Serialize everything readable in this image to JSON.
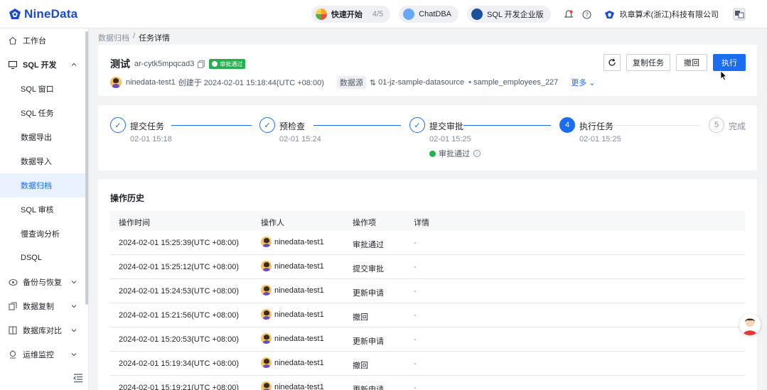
{
  "app": {
    "logo_text": "NineData",
    "brand_color": "#1a4bcf",
    "accent_color": "#1a6cf0"
  },
  "topbar": {
    "quickstart_label": "快速开始",
    "quickstart_count": "4/5",
    "chatdba_label": "ChatDBA",
    "edition_label": "SQL 开发企业版",
    "company": "玖章算术(浙江)科技有限公司",
    "icons": [
      "notification-icon",
      "help-icon",
      "company-icon",
      "language-icon"
    ]
  },
  "sidebar": {
    "items": [
      {
        "label": "工作台",
        "icon": "home-icon"
      },
      {
        "label": "SQL 开发",
        "icon": "sql-dev-icon"
      },
      {
        "label": "SQL 窗口"
      },
      {
        "label": "SQL 任务"
      },
      {
        "label": "数据导出"
      },
      {
        "label": "数据导入"
      },
      {
        "label": "数据归档"
      },
      {
        "label": "SQL 审核"
      },
      {
        "label": "慢查询分析"
      },
      {
        "label": "DSQL"
      },
      {
        "label": "备份与恢复",
        "icon": "backup-icon"
      },
      {
        "label": "数据复制",
        "icon": "replication-icon"
      },
      {
        "label": "数据库对比",
        "icon": "compare-icon"
      },
      {
        "label": "运维监控",
        "icon": "monitor-icon"
      }
    ],
    "active_item": "数据归档"
  },
  "breadcrumb": {
    "parent": "数据归档",
    "separator": "/",
    "current": "任务详情"
  },
  "task": {
    "title": "测试",
    "id": "ar-cytk5mpqcad3",
    "status_badge": "审批通过",
    "creator": "ninedata-test1",
    "created_text": "创建于 2024-02-01 15:18:44(UTC +08:00)",
    "datasource_label": "数据源",
    "datasource": "01-jz-sample-datasource",
    "database": "sample_employees_227",
    "more_label": "更多"
  },
  "actions": {
    "copy_label": "复制任务",
    "revoke_label": "撤回",
    "execute_label": "执行"
  },
  "steps": [
    {
      "index": "1",
      "label": "提交任务",
      "time": "02-01 15:18",
      "state": "done"
    },
    {
      "index": "2",
      "label": "预检查",
      "time": "02-01 15:24",
      "state": "done"
    },
    {
      "index": "3",
      "label": "提交审批",
      "time": "02-01 15:25",
      "state": "done",
      "extra": "审批通过"
    },
    {
      "index": "4",
      "label": "执行任务",
      "time": "02-01 15:25",
      "state": "current"
    },
    {
      "index": "5",
      "label": "完成",
      "time": "",
      "state": "pending"
    }
  ],
  "history": {
    "title": "操作历史",
    "columns": [
      "操作时间",
      "操作人",
      "操作项",
      "详情"
    ],
    "rows": [
      {
        "time": "2024-02-01 15:25:39(UTC +08:00)",
        "user": "ninedata-test1",
        "action": "审批通过",
        "detail": "-"
      },
      {
        "time": "2024-02-01 15:25:12(UTC +08:00)",
        "user": "ninedata-test1",
        "action": "提交审批",
        "detail": "-"
      },
      {
        "time": "2024-02-01 15:24:53(UTC +08:00)",
        "user": "ninedata-test1",
        "action": "更新申请",
        "detail": "-"
      },
      {
        "time": "2024-02-01 15:21:56(UTC +08:00)",
        "user": "ninedata-test1",
        "action": "撤回",
        "detail": "-"
      },
      {
        "time": "2024-02-01 15:20:53(UTC +08:00)",
        "user": "ninedata-test1",
        "action": "更新申请",
        "detail": "-"
      },
      {
        "time": "2024-02-01 15:19:34(UTC +08:00)",
        "user": "ninedata-test1",
        "action": "撤回",
        "detail": "-"
      },
      {
        "time": "2024-02-01 15:19:21(UTC +08:00)",
        "user": "ninedata-test1",
        "action": "更新申请",
        "detail": "-"
      }
    ]
  }
}
